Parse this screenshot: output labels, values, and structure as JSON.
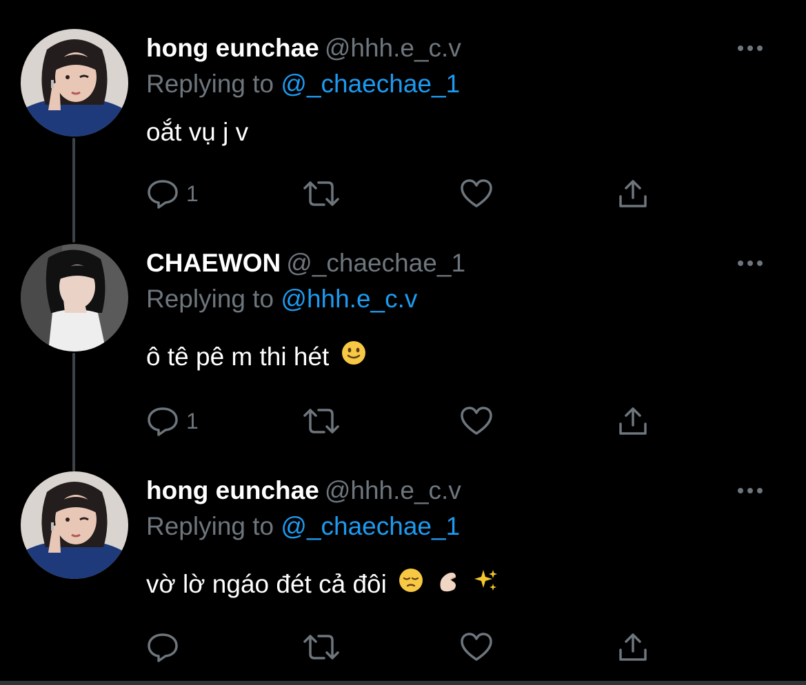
{
  "colors": {
    "background": "#000000",
    "name": "#ffffff",
    "muted": "#6e767d",
    "mention": "#1d9bf0",
    "thread_line": "#3d4248"
  },
  "tweets": [
    {
      "display_name": "hong eunchae",
      "handle": "@hhh.e_c.v",
      "replying_prefix": "Replying to",
      "replying_to": "@_chaechae_1",
      "text": "oắt vụ j v",
      "emojis": [],
      "reply_count": "1",
      "icons": [
        "reply-icon",
        "retweet-icon",
        "like-icon",
        "share-icon",
        "more-icon"
      ]
    },
    {
      "display_name": "CHAEWON",
      "handle": "@_chaechae_1",
      "replying_prefix": "Replying to",
      "replying_to": "@hhh.e_c.v",
      "text": "ô tê pê m thi hét",
      "emojis": [
        "slightly-smiling-face-emoji"
      ],
      "reply_count": "1",
      "icons": [
        "reply-icon",
        "retweet-icon",
        "like-icon",
        "share-icon",
        "more-icon"
      ]
    },
    {
      "display_name": "hong eunchae",
      "handle": "@hhh.e_c.v",
      "replying_prefix": "Replying to",
      "replying_to": "@_chaechae_1",
      "text": "vờ lờ ngáo đét cả đôi",
      "emojis": [
        "pensive-face-emoji",
        "pinching-hand-emoji",
        "sparkles-emoji"
      ],
      "reply_count": "",
      "icons": [
        "reply-icon",
        "retweet-icon",
        "like-icon",
        "share-icon",
        "more-icon"
      ]
    }
  ]
}
